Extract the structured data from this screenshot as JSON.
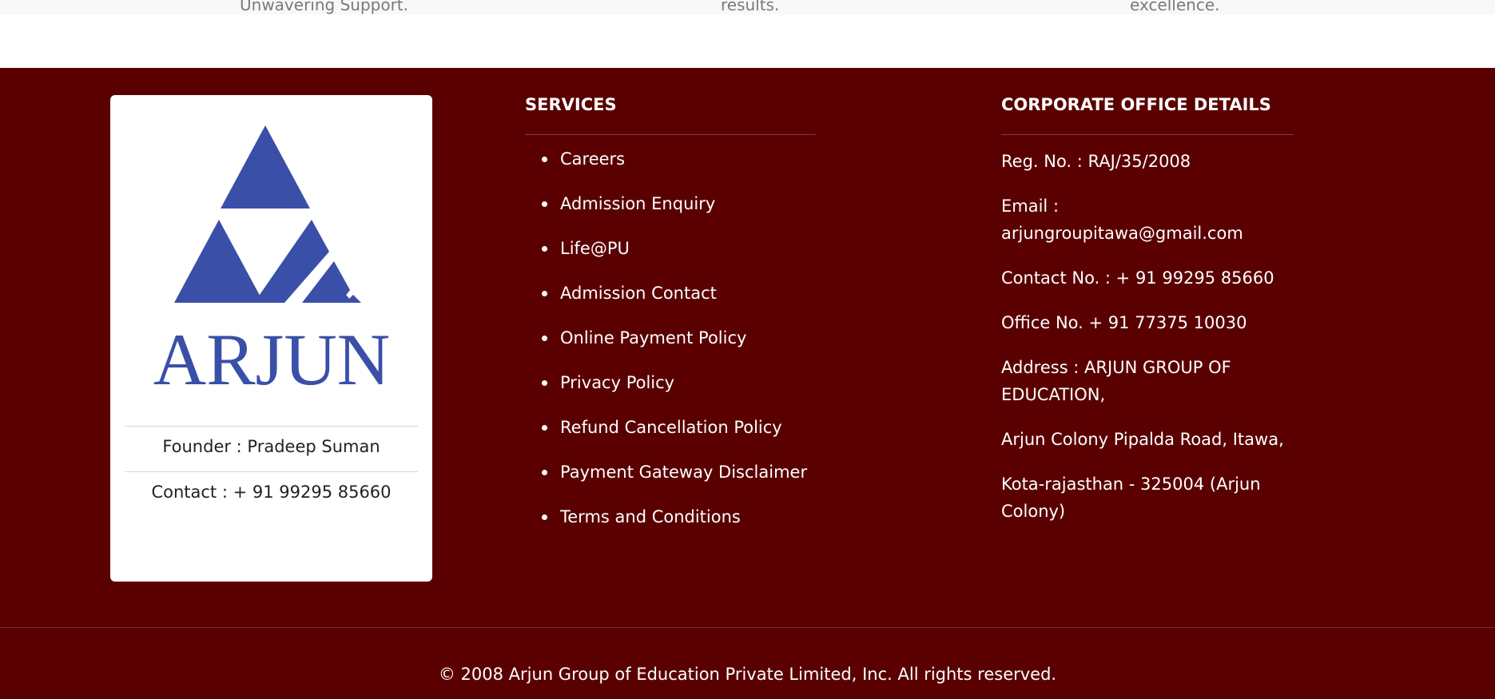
{
  "top_strip": {
    "items": [
      "Unwavering Support.",
      "results.",
      "excellence."
    ]
  },
  "brand": {
    "logo_text": "ARJUN",
    "logo_color": "#3a4fa8",
    "founder": "Founder : Pradeep Suman",
    "contact": "Contact : + 91 99295 85660"
  },
  "services": {
    "title": "SERVICES",
    "items": [
      "Careers",
      "Admission Enquiry",
      "Life@PU",
      "Admission Contact",
      "Online Payment Policy",
      "Privacy Policy",
      "Refund Cancellation Policy",
      "Payment Gateway Disclaimer",
      "Terms and Conditions"
    ]
  },
  "office": {
    "title": "CORPORATE OFFICE DETAILS",
    "lines": [
      "Reg. No. : RAJ/35/2008",
      "Email : arjungroupitawa@gmail.com",
      "Contact No. : + 91 99295 85660",
      "Office No. + 91 77375 10030",
      "Address : ARJUN GROUP OF EDUCATION,",
      "Arjun Colony Pipalda Road, Itawa,",
      "Kota-rajasthan - 325004 (Arjun Colony)"
    ]
  },
  "footer": {
    "copyright": "© 2008 Arjun Group of Education Private Limited, Inc. All rights reserved.",
    "background": "#5a0000"
  }
}
